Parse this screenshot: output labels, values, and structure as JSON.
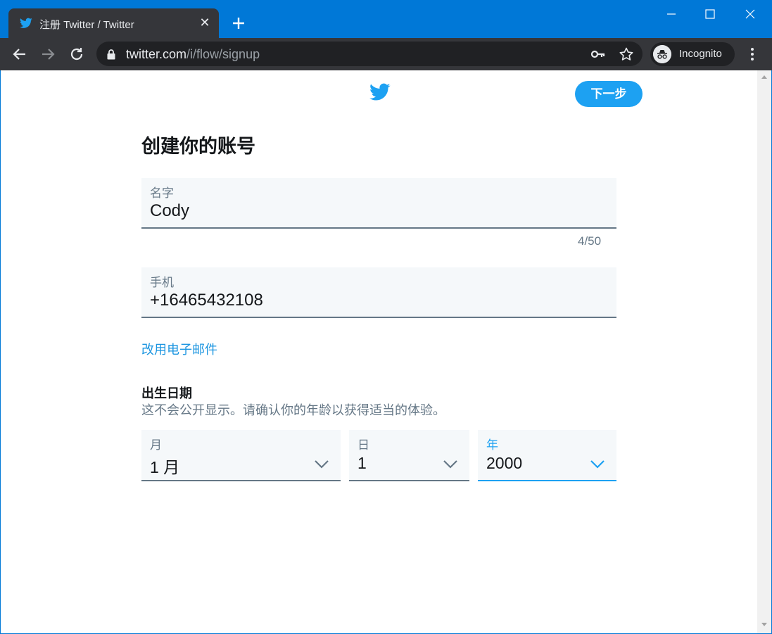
{
  "browser": {
    "tab_title": "注册 Twitter / Twitter",
    "url_host": "twitter.com",
    "url_path": "/i/flow/signup",
    "profile_label": "Incognito"
  },
  "page": {
    "next_button": "下一步",
    "heading": "创建你的账号",
    "name_field": {
      "label": "名字",
      "value": "Cody",
      "counter": "4/50"
    },
    "phone_field": {
      "label": "手机",
      "value": "+16465432108"
    },
    "use_email_link": "改用电子邮件",
    "dob": {
      "title": "出生日期",
      "description": "这不会公开显示。请确认你的年龄以获得适当的体验。",
      "month": {
        "label": "月",
        "value": "1 月"
      },
      "day": {
        "label": "日",
        "value": "1"
      },
      "year": {
        "label": "年",
        "value": "2000"
      }
    }
  },
  "colors": {
    "window_accent": "#0078d7",
    "twitter_blue": "#1da1f2",
    "link_blue": "#1b95e0",
    "field_bg": "#f5f8fa",
    "muted_text": "#657786"
  },
  "icons": [
    "twitter-bird-icon",
    "tab-close-icon",
    "new-tab-icon",
    "minimize-icon",
    "maximize-icon",
    "window-close-icon",
    "back-icon",
    "forward-icon",
    "reload-icon",
    "lock-icon",
    "key-icon",
    "star-icon",
    "incognito-icon",
    "more-menu-icon",
    "chevron-down-icon"
  ]
}
